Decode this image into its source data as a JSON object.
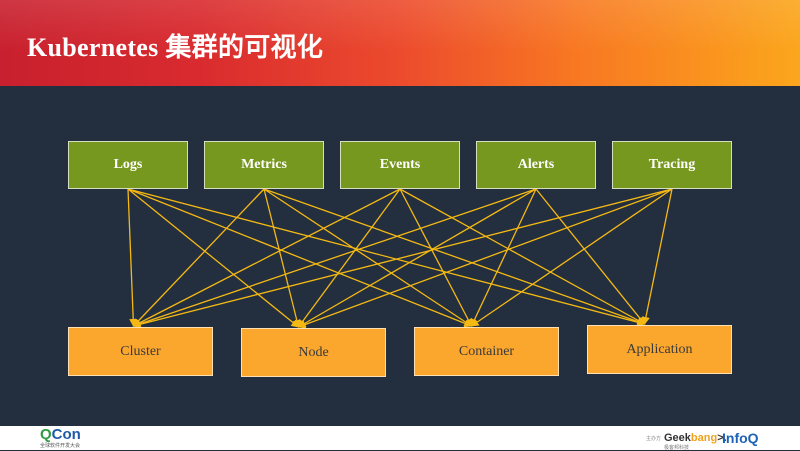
{
  "header": {
    "title": "Kubernetes 集群的可视化"
  },
  "diagram": {
    "sources": [
      {
        "label": "Logs"
      },
      {
        "label": "Metrics"
      },
      {
        "label": "Events"
      },
      {
        "label": "Alerts"
      },
      {
        "label": "Tracing"
      }
    ],
    "targets": [
      {
        "label": "Cluster"
      },
      {
        "label": "Node"
      },
      {
        "label": "Container"
      },
      {
        "label": "Application"
      }
    ],
    "colors": {
      "source_fill": "#77981f",
      "target_fill": "#fba62c",
      "connector": "#f5b914",
      "background": "#232f3e"
    }
  },
  "footer": {
    "qcon_q": "Q",
    "qcon_rest": "Con",
    "qcon_sub": "全球软件开发大会",
    "org_tag": "主办方",
    "geek_pre": "Geek",
    "geek_accent": "bang",
    "geek_post": ">.",
    "geek_sub": "极客邦科技",
    "infoq": "InfoQ"
  }
}
